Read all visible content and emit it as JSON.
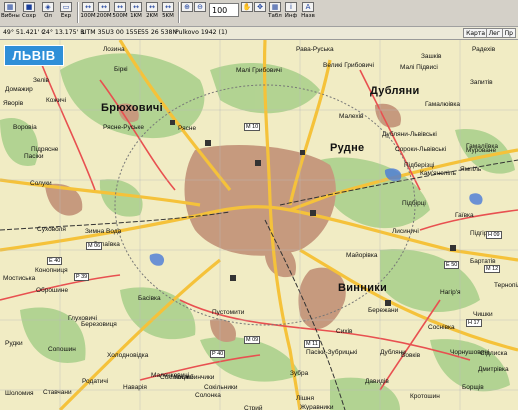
{
  "toolbar": {
    "buttons": [
      {
        "label": "Вибны",
        "icon": "table-icon"
      },
      {
        "label": "Сохр",
        "icon": "save-icon"
      },
      {
        "label": "Ол",
        "icon": "layer-icon"
      },
      {
        "label": "Екр",
        "icon": "screen-icon"
      },
      {
        "label": "100M",
        "icon": "scale-icon"
      },
      {
        "label": "200M",
        "icon": "scale-icon"
      },
      {
        "label": "500M",
        "icon": "scale-icon"
      },
      {
        "label": "1KM",
        "icon": "scale-icon"
      },
      {
        "label": "2KM",
        "icon": "scale-icon"
      },
      {
        "label": "5KM",
        "icon": "scale-icon"
      }
    ],
    "zoom_value": "100",
    "right_buttons": [
      {
        "label": "Табл",
        "icon": "table-icon"
      },
      {
        "label": "Инф",
        "icon": "info-icon"
      },
      {
        "label": "Назв",
        "icon": "text-icon"
      }
    ]
  },
  "status": {
    "lat": "49° 51.421' C",
    "lon": "24° 13.175' B",
    "utm": "UTM  35U",
    "east": "3 00 155E",
    "north": "55 26 538N",
    "datum": "Pulkovo 1942 (1)"
  },
  "tabs": [
    "Карта",
    "Лег",
    "Пр"
  ],
  "map": {
    "title": "ЛЬВІВ",
    "places": [
      "Лозина",
      "Рава-Руська",
      "Радехів",
      "Зашків",
      "Запитів",
      "Великі Грибовичі",
      "Малі Підвисі",
      "Біркі",
      "Брюховичі",
      "Малі Грибовичі",
      "Дубляни",
      "Гамалюівка",
      "Зелів",
      "Кожичі",
      "Домажир",
      "Рясне-Руське",
      "Рясне",
      "Малехів",
      "Дубляни-Львівські",
      "Сороки-Львівські",
      "Яворів",
      "Воровіа",
      "Підрясне",
      "Солуки",
      "Рудне",
      "Мурованe",
      "Ямпіль",
      "Підберізці",
      "Кам'янопіль",
      "Пасіки",
      "Суховоля",
      "Зимна Вода",
      "Кротошин",
      "Сихів",
      "Винники",
      "Підбірці",
      "Лисиничі",
      "Березовиця",
      "Нагір'я",
      "Солонка",
      "Пустомити",
      "Пасіки-Зубрицькі",
      "Сокільники",
      "Басівка",
      "Родатичі",
      "Лапаївка",
      "Оброшине",
      "Конопниця",
      "Глуховичі",
      "Сокільники",
      "Майорівка",
      "Бережани",
      "Соснівка",
      "Сідлиска",
      "Чишки",
      "Тернопіль",
      "Дмитрівка",
      "Вовків",
      "Борщів",
      "Дубляни",
      "Чорнушовичі",
      "Ставчани",
      "Малечковичі",
      "Стрий",
      "Наварія",
      "Підгірне",
      "Лішня",
      "Журавники",
      "Зубра",
      "Давидів",
      "Шоломия",
      "Гаївка",
      "Бартатів",
      "Мостиська",
      "Рудки",
      "Сопошин",
      "Холодновідка",
      "Коцюбинчики",
      "Гамаліївка"
    ],
    "road_labels": [
      "M 10",
      "M 11",
      "M 12",
      "M 06",
      "E 40",
      "E 50",
      "H 17",
      "P 39",
      "P 40",
      "M 09",
      "H 09"
    ]
  }
}
